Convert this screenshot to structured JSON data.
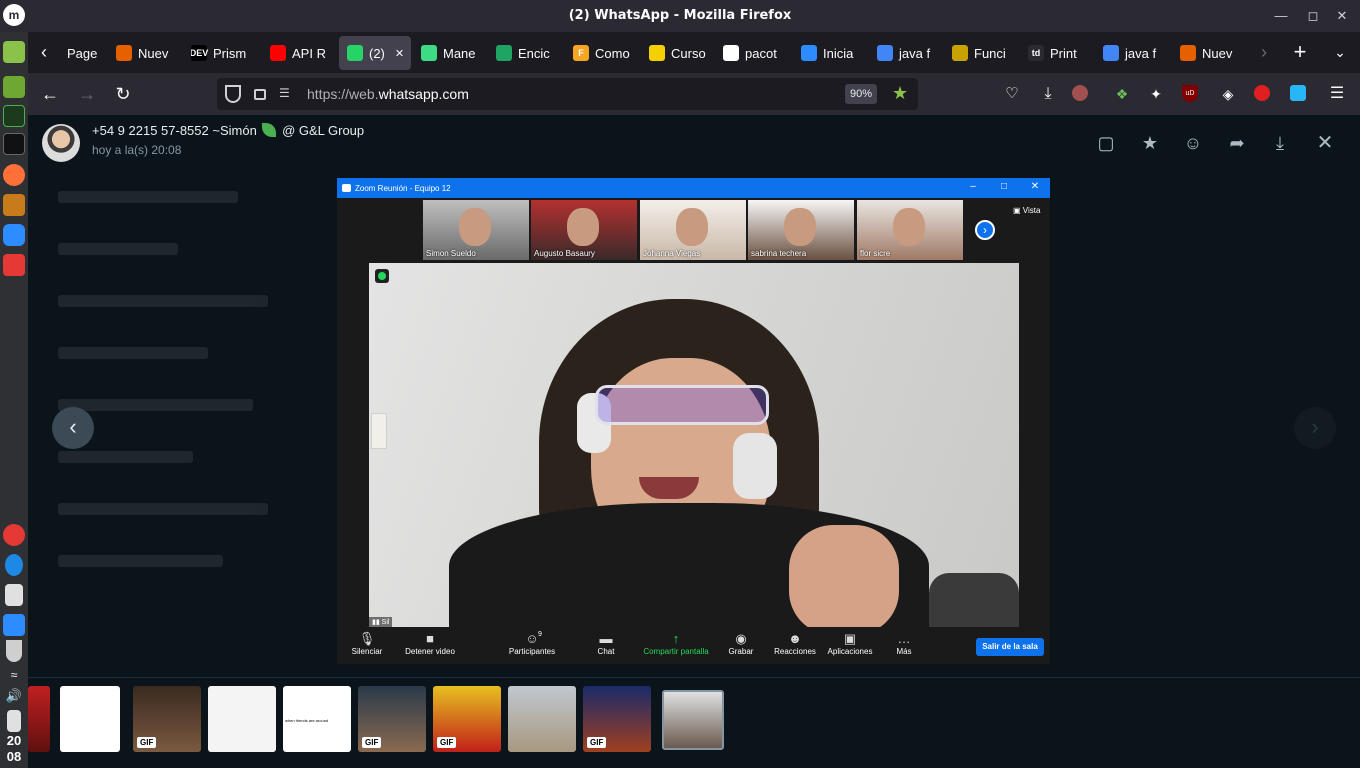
{
  "window": {
    "title": "(2) WhatsApp - Mozilla Firefox"
  },
  "tabs": [
    {
      "label": "Page",
      "icon": "page-icon",
      "color": "#1c1b22"
    },
    {
      "label": "Nuev",
      "icon": "firefox-icon",
      "color": "#e66000"
    },
    {
      "label": "Prism",
      "icon": "dev-icon",
      "color": "#000000",
      "badge": "DEV"
    },
    {
      "label": "API R",
      "icon": "youtube-icon",
      "color": "#ff0000"
    },
    {
      "label": "(2)",
      "icon": "whatsapp-icon",
      "color": "#25d366"
    },
    {
      "label": "Mane",
      "icon": "diamond-icon",
      "color": "#3ddc84"
    },
    {
      "label": "Encic",
      "icon": "drive-icon",
      "color": "#1fa463"
    },
    {
      "label": "Como",
      "icon": "f-icon",
      "color": "#f5a623",
      "badge": "F"
    },
    {
      "label": "Curso",
      "icon": "lightbulb-icon",
      "color": "#f5d000"
    },
    {
      "label": "pacot",
      "icon": "github-icon",
      "color": "#ffffff"
    },
    {
      "label": "Inicia",
      "icon": "zoom-icon",
      "color": "#2d8cff"
    },
    {
      "label": "java f",
      "icon": "google-icon",
      "color": "#4285f4"
    },
    {
      "label": "Funci",
      "icon": "function-icon",
      "color": "#c7a300"
    },
    {
      "label": "Print",
      "icon": "td-icon",
      "color": "#2b2a33",
      "badge": "td"
    },
    {
      "label": "java f",
      "icon": "google-icon",
      "color": "#4285f4"
    },
    {
      "label": "Nuev",
      "icon": "firefox-icon",
      "color": "#e66000"
    }
  ],
  "nav": {
    "url_prefix": "https://web.",
    "url_domain": "whatsapp.com",
    "zoom": "90%"
  },
  "viewer": {
    "sender": "+54 9 2215 57-8552 ~Simón",
    "group": "@ G&L Group",
    "timestamp": "hoy a la(s) 20:08"
  },
  "zoom_window": {
    "title": "Zoom Reunión - Equipo 12",
    "view_label": "Vista",
    "participants": [
      "Simon Sueldo",
      "Augusto Basaury",
      "Johanna Viegas",
      "sabrina techera",
      "flor sicre"
    ],
    "signal_label": "Sil",
    "toolbar": [
      {
        "label": "Silenciar",
        "icon": "microphone-icon"
      },
      {
        "label": "Detener video",
        "icon": "camera-icon"
      },
      {
        "label": "Participantes",
        "icon": "participants-icon",
        "count": "9"
      },
      {
        "label": "Chat",
        "icon": "chat-icon"
      },
      {
        "label": "Compartir pantalla",
        "icon": "share-screen-icon"
      },
      {
        "label": "Grabar",
        "icon": "record-icon"
      },
      {
        "label": "Reacciones",
        "icon": "reactions-icon"
      },
      {
        "label": "Aplicaciones",
        "icon": "apps-icon"
      },
      {
        "label": "Más",
        "icon": "more-icon"
      }
    ],
    "leave_label": "Salir de la sala",
    "share_color": "#23d959"
  },
  "strip": [
    {
      "kind": "document",
      "gif": ""
    },
    {
      "kind": "photo",
      "gif": "GIF"
    },
    {
      "kind": "meme",
      "gif": ""
    },
    {
      "kind": "meme",
      "gif": "",
      "caption": "when friends are around"
    },
    {
      "kind": "photo",
      "gif": "GIF"
    },
    {
      "kind": "photo",
      "gif": "GIF"
    },
    {
      "kind": "photo",
      "gif": ""
    },
    {
      "kind": "photo",
      "gif": "GIF"
    },
    {
      "kind": "selected",
      "gif": ""
    }
  ],
  "clock": {
    "hours": "20",
    "minutes": "08"
  }
}
